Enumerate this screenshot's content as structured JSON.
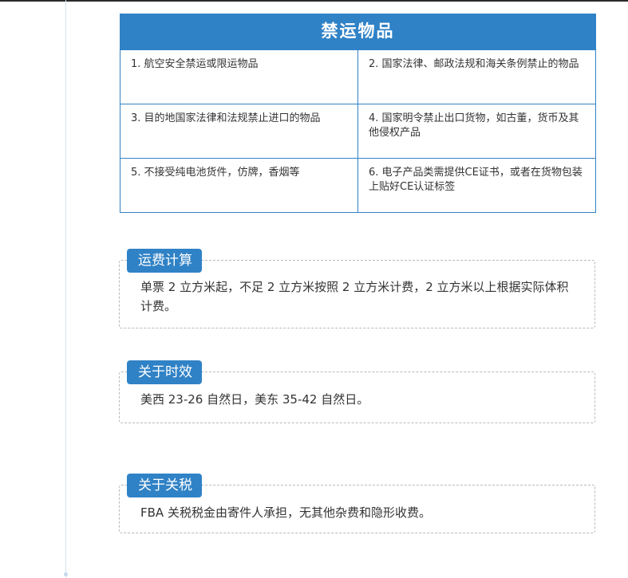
{
  "restricted": {
    "title": "禁运物品",
    "items": [
      "1.  航空安全禁运或限运物品",
      "2. 国家法律、邮政法规和海关条例禁止的物品",
      "3. 目的地国家法律和法规禁止进口的物品",
      "4.  国家明令禁止出口货物，如古董，货币及其他侵权产品",
      "5. 不接受纯电池货件，仿牌，香烟等",
      "6. 电子产品类需提供CE证书，或者在货物包装上贴好CE认证标签"
    ]
  },
  "shipping_fee": {
    "label": "运费计算",
    "text": "单票 2 立方米起，不足 2 立方米按照 2 立方米计费，2 立方米以上根据实际体积计费。"
  },
  "transit_time": {
    "label": "关于时效",
    "text": "美西  23-26 自然日，美东  35-42 自然日。"
  },
  "duties": {
    "label": "关于关税",
    "text": "FBA 关税税金由寄件人承担，无其他杂费和隐形收费。"
  },
  "colors": {
    "accent": "#3082c6",
    "text": "#333333",
    "dashed_border": "#b9b9b9"
  }
}
